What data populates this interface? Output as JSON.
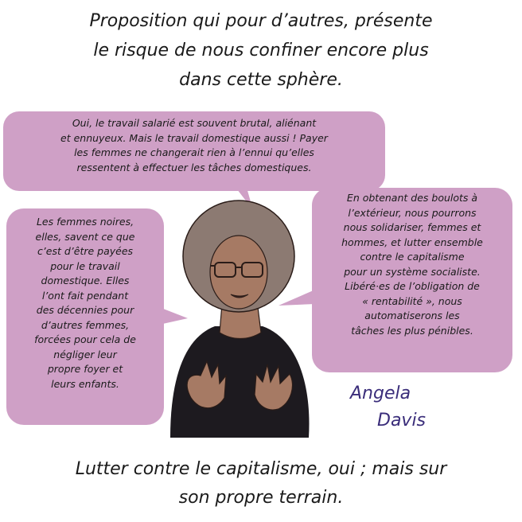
{
  "caption_top": {
    "line1": "Proposition qui pour d’autres, présente",
    "line2": "le risque de nous confiner encore plus",
    "line3": "dans cette sphère."
  },
  "bubble_top": {
    "lines": [
      "Oui, le travail salarié est souvent brutal, aliénant",
      "et ennuyeux. Mais le travail domestique aussi ! Payer",
      "les femmes ne changerait rien à l’ennui qu’elles",
      "ressentent à effectuer les tâches domestiques."
    ]
  },
  "bubble_left": {
    "lines": [
      "Les femmes noires,",
      "elles, savent ce que",
      "c’est d’être payées",
      "pour le travail",
      "domestique. Elles",
      "l’ont fait pendant",
      "des décennies pour",
      "d’autres femmes,",
      "forcées pour cela de",
      "négliger leur",
      "propre foyer et",
      "leurs enfants."
    ]
  },
  "bubble_right": {
    "lines": [
      "En obtenant des boulots à",
      "l’extérieur, nous pourrons",
      "nous solidariser, femmes et",
      "hommes, et lutter ensemble",
      "contre le capitalisme",
      "pour un système socialiste.",
      "Libéré·es de l’obligation de",
      "« rentabilité », nous",
      "automatiserons les",
      "tâches les plus pénibles."
    ]
  },
  "signature": {
    "line1": "Angela",
    "line2": "Davis"
  },
  "caption_bottom": {
    "line1": "Lutter contre le capitalisme, oui ; mais sur",
    "line2": "son propre terrain."
  },
  "colors": {
    "bubble": "#cfa0c6",
    "signature": "#3a2d7a",
    "hair": "#8c7a72",
    "skin": "#a67a64",
    "shirt": "#1d1a1f"
  }
}
